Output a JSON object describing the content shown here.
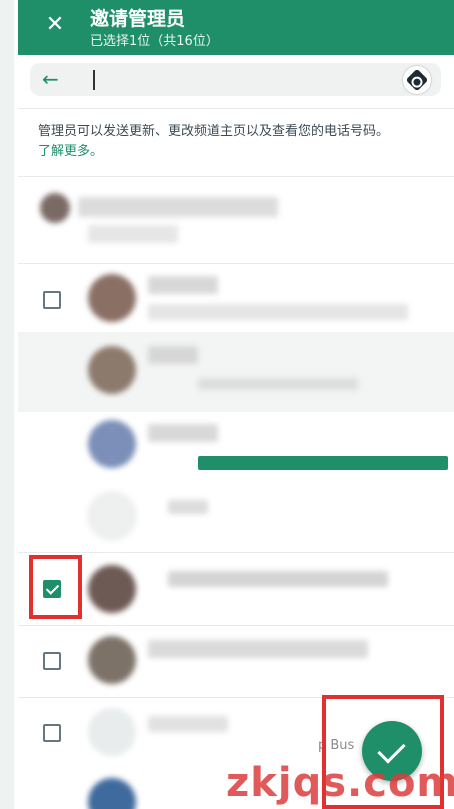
{
  "header": {
    "close_icon": "close-icon",
    "title": "邀请管理员",
    "subtitle": "已选择1位（共16位）"
  },
  "search": {
    "back_icon": "back-arrow-icon",
    "value": "",
    "badge_icon": "app-badge-icon"
  },
  "info": {
    "text": "管理员可以发送更新、更改频道主页以及查看您的电话号码。",
    "link": "了解更多。"
  },
  "contacts": [
    {
      "checked": false,
      "name": "",
      "status": ""
    },
    {
      "checked": false,
      "name": "",
      "status": ""
    },
    {
      "checked": false,
      "name": "",
      "status": ""
    },
    {
      "checked": false,
      "name": "",
      "status": ""
    },
    {
      "checked": false,
      "name": "",
      "status": ""
    },
    {
      "checked": true,
      "name": "",
      "status": ""
    },
    {
      "checked": false,
      "name": "",
      "status": ""
    },
    {
      "checked": false,
      "name": "",
      "status": "p Bus"
    }
  ],
  "fab": {
    "icon": "confirm-check-icon"
  },
  "watermark": "zkjqs.com",
  "colors": {
    "brand": "#1e8f68",
    "highlight": "#e0302f"
  }
}
